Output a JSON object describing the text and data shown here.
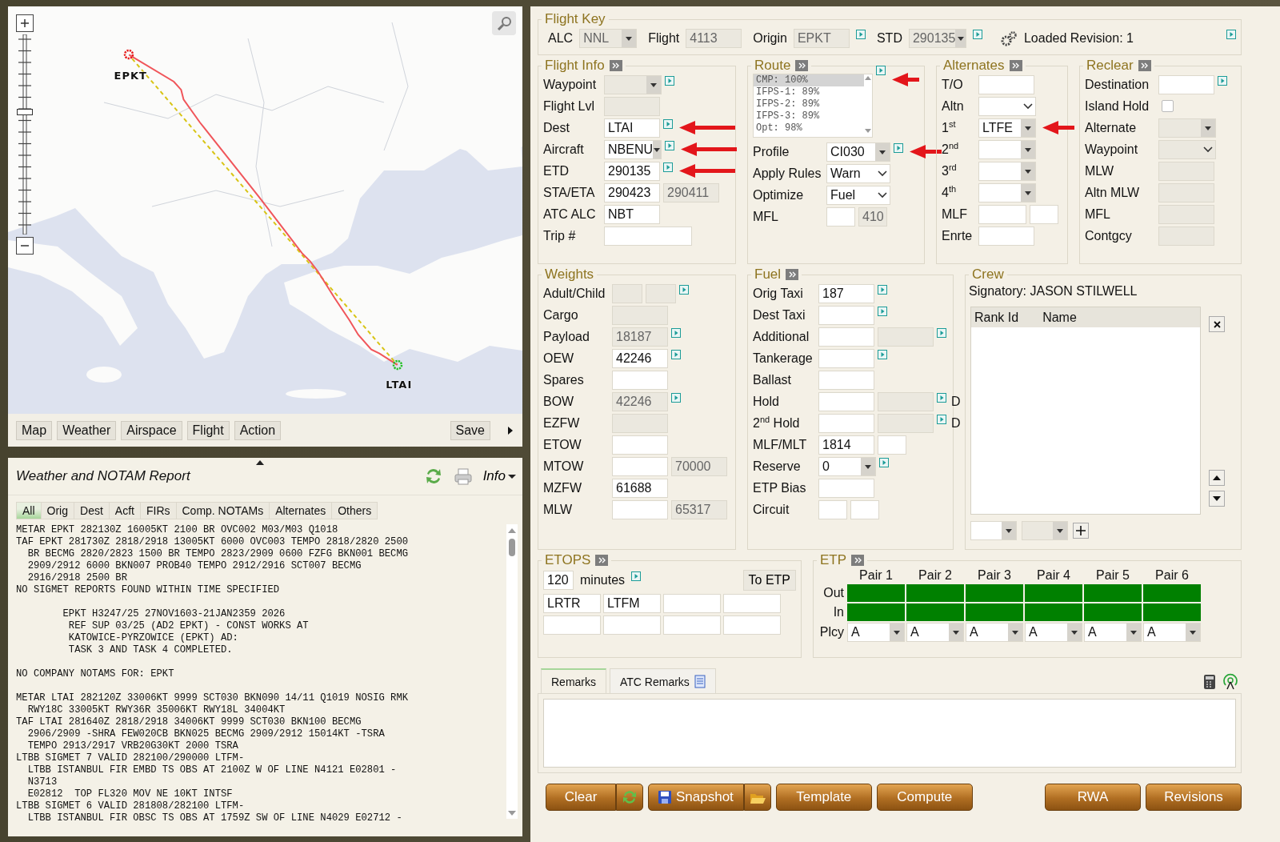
{
  "map": {
    "zoom": {
      "level": 0.6
    },
    "markers": [
      {
        "label": "EPKT",
        "kind": "origin"
      },
      {
        "label": "LTAI",
        "kind": "destination"
      }
    ],
    "toolbar": [
      "Map",
      "Weather",
      "Airspace",
      "Flight",
      "Action"
    ],
    "save": "Save"
  },
  "weather": {
    "title": "Weather and NOTAM Report",
    "menu": "Info",
    "tabs": [
      {
        "label": "All",
        "selected": true
      },
      {
        "label": "Orig",
        "selected": false
      },
      {
        "label": "Dest",
        "selected": false
      },
      {
        "label": "Acft",
        "selected": false
      },
      {
        "label": "FIRs",
        "selected": false
      },
      {
        "label": "Comp. NOTAMs",
        "selected": false
      },
      {
        "label": "Alternates",
        "selected": false
      },
      {
        "label": "Others",
        "selected": false
      }
    ],
    "report": [
      [
        "METAR EPKT 282130Z 16005KT 2100 BR OVC002 M03/M03 Q1018",
        "TAF EPKT 281730Z 2818/2918 13005KT 6000 OVC003 TEMPO 2818/2820 2500",
        "  BR BECMG 2820/2823 1500 BR TEMPO 2823/2909 0600 FZFG BKN001 BECMG",
        "  2909/2912 6000 BKN007 PROB40 TEMPO 2912/2916 SCT007 BECMG",
        "  2916/2918 2500 BR",
        "NO SIGMET REPORTS FOUND WITHIN TIME SPECIFIED"
      ],
      [
        "        EPKT H3247/25 27NOV1603-21JAN2359 2026",
        "         REF SUP 03/25 (AD2 EPKT) - CONST WORKS AT",
        "         KATOWICE-PYRZOWICE (EPKT) AD:",
        "         TASK 3 AND TASK 4 COMPLETED."
      ],
      [
        "NO COMPANY NOTAMS FOR: EPKT"
      ],
      [
        "METAR LTAI 282120Z 33006KT 9999 SCT030 BKN090 14/11 Q1019 NOSIG RMK",
        "  RWY18C 33005KT RWY36R 35006KT RWY18L 34004KT",
        "TAF LTAI 281640Z 2818/2918 34006KT 9999 SCT030 BKN100 BECMG",
        "  2906/2909 -SHRA FEW020CB BKN025 BECMG 2909/2912 15014KT -TSRA",
        "  TEMPO 2913/2917 VRB20G30KT 2000 TSRA",
        "LTBB SIGMET 7 VALID 282100/290000 LTFM-",
        "  LTBB ISTANBUL FIR EMBD TS OBS AT 2100Z W OF LINE N4121 E02801 -",
        "  N3713",
        "  E02812  TOP FL320 MOV NE 10KT INTSF",
        "LTBB SIGMET 6 VALID 281808/282100 LTFM-",
        "  LTBB ISTANBUL FIR OBSC TS OBS AT 1759Z SW OF LINE N4029 E02712 -"
      ]
    ]
  },
  "flight_key": {
    "title": "Flight Key",
    "fields": [
      {
        "label": "ALC",
        "value": "NNL",
        "kind": "select",
        "disabled": true,
        "link": false
      },
      {
        "label": "Flight",
        "value": "4113",
        "kind": "text",
        "disabled": true,
        "link": false
      },
      {
        "label": "Origin",
        "value": "EPKT",
        "kind": "text",
        "disabled": true,
        "link": true
      },
      {
        "label": "STD",
        "value": "290135",
        "kind": "select",
        "disabled": true,
        "link": true
      }
    ],
    "revision": "Loaded Revision: 1"
  },
  "flight_info": {
    "title": "Flight Info",
    "rows": [
      {
        "label": "Waypoint",
        "link": true,
        "arrow": false,
        "fields": [
          {
            "kind": "select",
            "disabled": true
          }
        ]
      },
      {
        "label": "Flight Lvl",
        "link": false,
        "arrow": false,
        "fields": [
          {
            "kind": "text",
            "disabled": true
          }
        ]
      },
      {
        "label": "Dest",
        "link": true,
        "arrow": true,
        "fields": [
          {
            "kind": "text",
            "value": "LTAI",
            "disabled": false
          }
        ]
      },
      {
        "label": "Aircraft",
        "link": true,
        "arrow": true,
        "fields": [
          {
            "kind": "select",
            "value": "NBENU",
            "disabled": false
          }
        ]
      },
      {
        "label": "ETD",
        "link": true,
        "arrow": true,
        "fields": [
          {
            "kind": "text",
            "value": "290135",
            "disabled": false
          }
        ]
      },
      {
        "label": "STA/ETA",
        "link": false,
        "arrow": false,
        "fields": [
          {
            "kind": "text",
            "value": "290423",
            "disabled": false
          },
          {
            "kind": "text",
            "value": "290411",
            "disabled": true
          }
        ]
      },
      {
        "label": "ATC ALC",
        "link": false,
        "arrow": false,
        "fields": [
          {
            "kind": "text",
            "value": "NBT",
            "disabled": false
          }
        ]
      },
      {
        "label": "Trip #",
        "link": false,
        "arrow": false,
        "fields": [
          {
            "kind": "wide",
            "disabled": false
          }
        ]
      }
    ]
  },
  "route": {
    "title": "Route",
    "link": true,
    "options": [
      {
        "label": "CMP: 100%",
        "selected": true,
        "arrow": true
      },
      {
        "label": "IFPS-1: 89%",
        "selected": false,
        "arrow": false
      },
      {
        "label": "IFPS-2: 89%",
        "selected": false,
        "arrow": false
      },
      {
        "label": "IFPS-3: 89%",
        "selected": false,
        "arrow": false
      },
      {
        "label": "Opt: 98%",
        "selected": false,
        "arrow": false
      }
    ],
    "rows": [
      {
        "label": "Profile",
        "link": true,
        "arrow": true,
        "fields": [
          {
            "kind": "select",
            "value": "CI030",
            "disabled": false
          }
        ]
      },
      {
        "label": "Apply Rules",
        "link": false,
        "arrow": false,
        "fields": [
          {
            "kind": "chevron",
            "value": "Warn",
            "disabled": false
          }
        ]
      },
      {
        "label": "Optimize",
        "link": false,
        "arrow": false,
        "fields": [
          {
            "kind": "chevron",
            "value": "Fuel",
            "disabled": false
          }
        ]
      },
      {
        "label": "MFL",
        "link": false,
        "arrow": false,
        "fields": [
          {
            "kind": "small",
            "disabled": false
          },
          {
            "kind": "small",
            "value": "410",
            "disabled": true
          }
        ]
      }
    ]
  },
  "alternates": {
    "title": "Alternates",
    "rows": [
      {
        "label": "T/O",
        "link": false,
        "arrow": false,
        "fields": [
          {
            "kind": "text",
            "disabled": false
          }
        ]
      },
      {
        "label": "Altn",
        "link": false,
        "arrow": false,
        "fields": [
          {
            "kind": "chevron",
            "disabled": false
          }
        ]
      },
      {
        "label": "1$^{st}$",
        "link": false,
        "arrow": true,
        "fields": [
          {
            "kind": "select",
            "value": "LTFE",
            "disabled": false
          }
        ]
      },
      {
        "label": "2$^{nd}$",
        "link": false,
        "arrow": false,
        "fields": [
          {
            "kind": "select",
            "disabled": false
          }
        ]
      },
      {
        "label": "3$^{rd}$",
        "link": false,
        "arrow": false,
        "fields": [
          {
            "kind": "select",
            "disabled": false
          }
        ]
      },
      {
        "label": "4$^{th}$",
        "link": false,
        "arrow": false,
        "fields": [
          {
            "kind": "select",
            "disabled": false
          }
        ]
      },
      {
        "label": "MLF",
        "link": false,
        "arrow": false,
        "fields": [
          {
            "kind": "mid",
            "disabled": false
          },
          {
            "kind": "small",
            "disabled": false
          }
        ]
      },
      {
        "label": "Enrte",
        "link": false,
        "arrow": false,
        "fields": [
          {
            "kind": "text",
            "disabled": false
          }
        ]
      }
    ]
  },
  "reclear": {
    "title": "Reclear",
    "rows": [
      {
        "label": "Destination",
        "link": true,
        "arrow": false,
        "fields": [
          {
            "kind": "text",
            "disabled": false
          }
        ]
      },
      {
        "label": "Island Hold",
        "link": false,
        "arrow": false,
        "fields": [
          {
            "kind": "checkbox",
            "checked": false,
            "disabled": false
          }
        ]
      },
      {
        "label": "Alternate",
        "link": false,
        "arrow": false,
        "fields": [
          {
            "kind": "select",
            "disabled": true
          }
        ]
      },
      {
        "label": "Waypoint",
        "link": false,
        "arrow": false,
        "fields": [
          {
            "kind": "chevron",
            "disabled": true
          }
        ]
      },
      {
        "label": "MLW",
        "link": false,
        "arrow": false,
        "fields": [
          {
            "kind": "text",
            "disabled": true
          }
        ]
      },
      {
        "label": "Altn MLW",
        "link": false,
        "arrow": false,
        "fields": [
          {
            "kind": "text",
            "disabled": true
          }
        ]
      },
      {
        "label": "MFL",
        "link": false,
        "arrow": false,
        "fields": [
          {
            "kind": "text",
            "disabled": true
          }
        ]
      },
      {
        "label": "Contgcy",
        "link": false,
        "arrow": false,
        "fields": [
          {
            "kind": "text",
            "disabled": true
          }
        ]
      }
    ]
  },
  "weights": {
    "title": "Weights",
    "rows": [
      {
        "label": "Adult/Child",
        "link": true,
        "arrow": false,
        "fields": [
          {
            "kind": "tiny",
            "disabled": true
          },
          {
            "kind": "tiny",
            "disabled": true
          }
        ]
      },
      {
        "label": "Cargo",
        "link": false,
        "arrow": false,
        "fields": [
          {
            "kind": "text",
            "disabled": true
          }
        ]
      },
      {
        "label": "Payload",
        "link": true,
        "arrow": false,
        "fields": [
          {
            "kind": "text",
            "value": "18187",
            "disabled": true
          }
        ]
      },
      {
        "label": "OEW",
        "link": true,
        "arrow": false,
        "fields": [
          {
            "kind": "text",
            "value": "42246",
            "disabled": false
          }
        ]
      },
      {
        "label": "Spares",
        "link": false,
        "arrow": false,
        "fields": [
          {
            "kind": "text",
            "disabled": false
          }
        ]
      },
      {
        "label": "BOW",
        "link": true,
        "arrow": false,
        "fields": [
          {
            "kind": "text",
            "value": "42246",
            "disabled": true
          }
        ]
      },
      {
        "label": "EZFW",
        "link": false,
        "arrow": false,
        "fields": [
          {
            "kind": "text",
            "disabled": true
          }
        ]
      },
      {
        "label": "ETOW",
        "link": false,
        "arrow": false,
        "fields": [
          {
            "kind": "text",
            "disabled": false
          }
        ]
      },
      {
        "label": "MTOW",
        "link": false,
        "arrow": false,
        "fields": [
          {
            "kind": "text",
            "disabled": false
          },
          {
            "kind": "text",
            "value": "70000",
            "disabled": true
          }
        ]
      },
      {
        "label": "MZFW",
        "link": false,
        "arrow": false,
        "fields": [
          {
            "kind": "text",
            "value": "61688",
            "disabled": false
          }
        ]
      },
      {
        "label": "MLW",
        "link": false,
        "arrow": false,
        "fields": [
          {
            "kind": "text",
            "disabled": false
          },
          {
            "kind": "text",
            "value": "65317",
            "disabled": true
          }
        ]
      }
    ]
  },
  "fuel": {
    "title": "Fuel",
    "rows": [
      {
        "label": "Orig Taxi",
        "link": true,
        "arrow": false,
        "fields": [
          {
            "kind": "text",
            "value": "187",
            "disabled": false
          }
        ]
      },
      {
        "label": "Dest Taxi",
        "link": true,
        "arrow": false,
        "fields": [
          {
            "kind": "text",
            "disabled": false
          }
        ]
      },
      {
        "label": "Additional",
        "link": true,
        "arrow": false,
        "fields": [
          {
            "kind": "text",
            "disabled": false
          },
          {
            "kind": "text",
            "disabled": true
          }
        ]
      },
      {
        "label": "Tankerage",
        "link": true,
        "arrow": false,
        "fields": [
          {
            "kind": "text",
            "disabled": false
          }
        ]
      },
      {
        "label": "Ballast",
        "link": false,
        "arrow": false,
        "fields": [
          {
            "kind": "text",
            "disabled": false
          }
        ]
      },
      {
        "label": "Hold",
        "link": true,
        "arrow": false,
        "suffix": "D",
        "fields": [
          {
            "kind": "text",
            "disabled": false
          },
          {
            "kind": "text",
            "disabled": true
          }
        ]
      },
      {
        "label": "2$^{nd}$ Hold",
        "link": true,
        "arrow": false,
        "suffix": "D",
        "fields": [
          {
            "kind": "text",
            "disabled": false
          },
          {
            "kind": "text",
            "disabled": true
          }
        ]
      },
      {
        "label": "MLF/MLT",
        "link": false,
        "arrow": false,
        "fields": [
          {
            "kind": "text",
            "value": "1814",
            "disabled": false
          },
          {
            "kind": "small",
            "disabled": false
          }
        ]
      },
      {
        "label": "Reserve",
        "link": true,
        "arrow": false,
        "fields": [
          {
            "kind": "select",
            "value": "0",
            "disabled": false
          }
        ]
      },
      {
        "label": "ETP Bias",
        "link": false,
        "arrow": false,
        "fields": [
          {
            "kind": "text",
            "disabled": false
          }
        ]
      },
      {
        "label": "Circuit",
        "link": false,
        "arrow": false,
        "fields": [
          {
            "kind": "small",
            "disabled": false
          },
          {
            "kind": "small",
            "disabled": false
          }
        ]
      }
    ]
  },
  "crew": {
    "title": "Crew",
    "signatory": "Signatory: JASON STILWELL",
    "columns": [
      "Rank Id",
      "Name"
    ]
  },
  "etops": {
    "title": "ETOPS",
    "minutes": "120",
    "unit": "minutes",
    "button": "To ETP",
    "cells": [
      {
        "value": "LRTR"
      },
      {
        "value": "LTFM"
      },
      {},
      {},
      {},
      {},
      {},
      {}
    ]
  },
  "etp": {
    "title": "ETP",
    "row_labels": [
      "Out",
      "In",
      "Plcy"
    ],
    "pairs": [
      {
        "label": "Pair 1",
        "policy": "A"
      },
      {
        "label": "Pair 2",
        "policy": "A"
      },
      {
        "label": "Pair 3",
        "policy": "A"
      },
      {
        "label": "Pair 4",
        "policy": "A"
      },
      {
        "label": "Pair 5",
        "policy": "A"
      },
      {
        "label": "Pair 6",
        "policy": "A"
      }
    ]
  },
  "remarks": {
    "tabs": [
      {
        "label": "Remarks",
        "selected": true
      },
      {
        "label": "ATC Remarks",
        "selected": false
      }
    ]
  },
  "buttons": [
    {
      "label": "Clear",
      "kind": "refresh"
    },
    {
      "label": "Snapshot",
      "kind": "snapshot"
    },
    {
      "label": "Template",
      "kind": "plain"
    },
    {
      "label": "Compute",
      "kind": "plain"
    }
  ],
  "buttons_right": [
    {
      "label": "RWA"
    },
    {
      "label": "Revisions"
    }
  ]
}
